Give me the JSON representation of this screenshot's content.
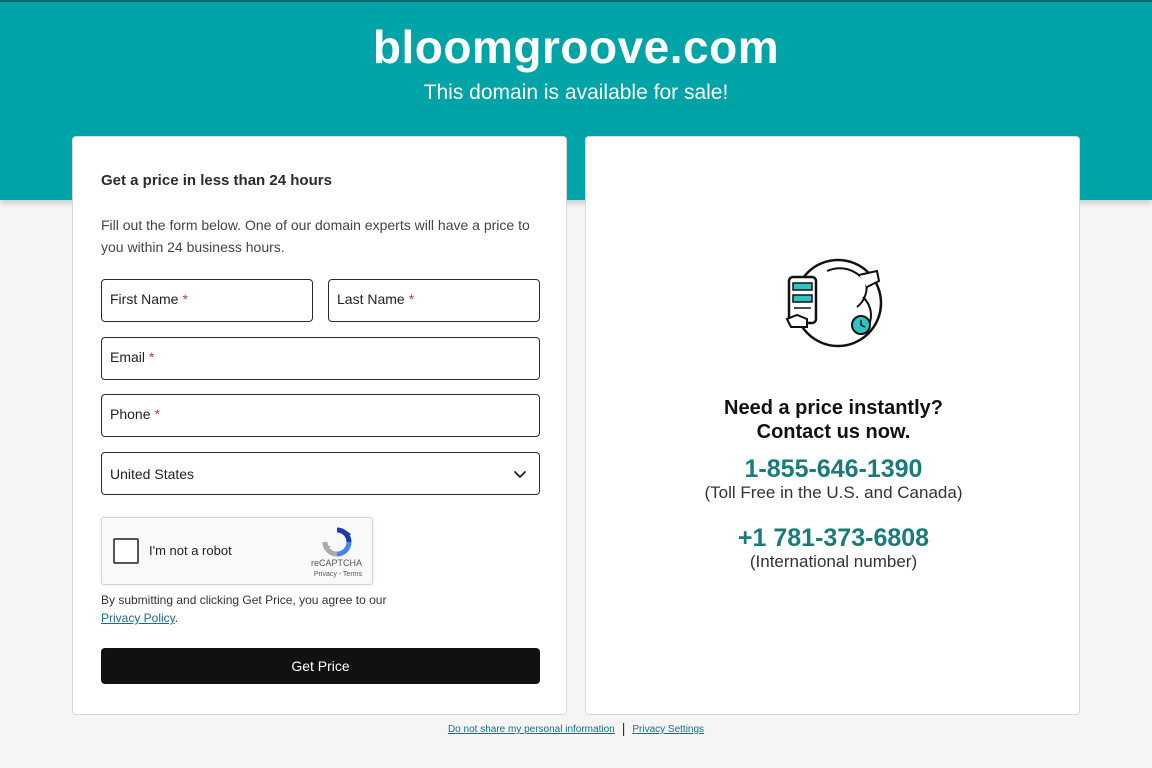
{
  "hero": {
    "title": "bloomgroove.com",
    "subtitle": "This domain is available for sale!",
    "background": "#00a4a6"
  },
  "form": {
    "heading": "Get a price in less than 24 hours",
    "description": "Fill out the form below. One of our domain experts will have a price to you within 24 business hours.",
    "first_name_label": "First Name",
    "last_name_label": "Last Name",
    "email_label": "Email",
    "phone_label": "Phone",
    "required_marker": "*",
    "country_selected": "United States",
    "recaptcha_label": "I'm not a robot",
    "recaptcha_brand": "reCAPTCHA",
    "recaptcha_terms": "Privacy - Terms",
    "legal_text": "By submitting and clicking Get Price, you agree to our",
    "privacy_link": "Privacy Policy",
    "legal_end": ".",
    "submit_label": "Get Price"
  },
  "contact": {
    "heading_line1": "Need a price instantly?",
    "heading_line2": "Contact us now.",
    "phone_tollfree": "1-855-646-1390",
    "phone_tollfree_note": "(Toll Free in the U.S. and Canada)",
    "phone_intl": "+1 781-373-6808",
    "phone_intl_note": "(International number)",
    "accent": "#1a7a7c",
    "illustration_icon": "phone-support-icon"
  },
  "footer": {
    "do_not_share": "Do not share my personal information",
    "separator": "|",
    "privacy_settings": "Privacy Settings"
  }
}
